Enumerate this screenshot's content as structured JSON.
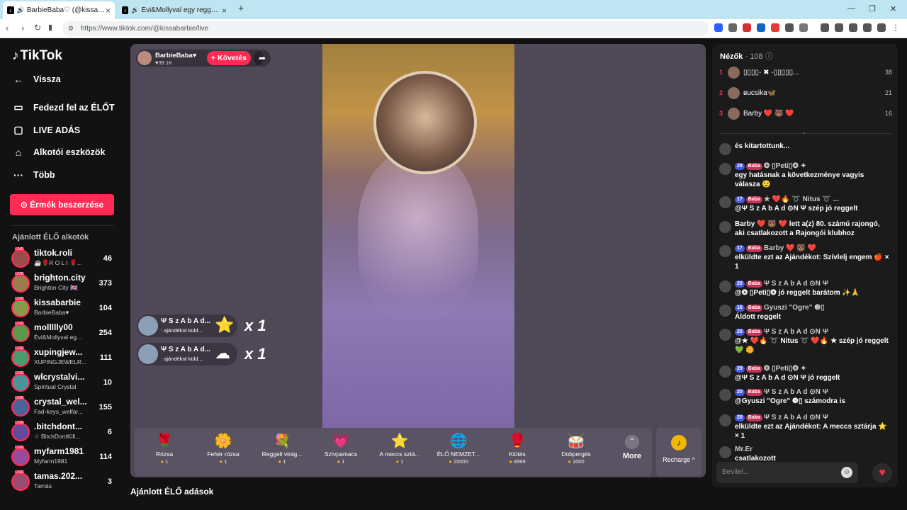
{
  "browser": {
    "tabs": [
      {
        "title": "BarbieBaba♡ (@kissabarbie"
      },
      {
        "title": "Évi&Mollyval egy reggeli 😊😍"
      }
    ],
    "url": "https://www.tiktok.com/@kissabarbie/live"
  },
  "sidebar": {
    "logo": "TikTok",
    "back": "Vissza",
    "nav": [
      "Fedezd fel az ÉLŐT",
      "LIVE ADÁS",
      "Alkotói eszközök",
      "Több"
    ],
    "coins_button": "Érmék beszerzése",
    "section_title": "Ajánlott ÉLŐ alkotók",
    "creators": [
      {
        "name": "tiktok.roli",
        "sub": "☕🌹R O L I 🌹...",
        "count": "46"
      },
      {
        "name": "brighton.city",
        "sub": "Brighton City 🇬🇧",
        "count": "373"
      },
      {
        "name": "kissabarbie",
        "sub": "BarbieBaba♥",
        "count": "104"
      },
      {
        "name": "mollllly00",
        "sub": "Évi&Mollyval eg...",
        "count": "254"
      },
      {
        "name": "xupingjew...",
        "sub": "XUPINGJEWELR...",
        "count": "111"
      },
      {
        "name": "wlcrystalvi...",
        "sub": "Spiritual Crystal",
        "count": "10"
      },
      {
        "name": "crystal_wel...",
        "sub": "Fad-keys_welfar...",
        "count": "155"
      },
      {
        "name": ".bitchdont...",
        "sub": "☆ BitchDontKill...",
        "count": "6"
      },
      {
        "name": "myfarm1981",
        "sub": "Myfarm1981",
        "count": "114"
      },
      {
        "name": "tamas.202...",
        "sub": "Tamás",
        "count": "3"
      }
    ]
  },
  "stream": {
    "host_name": "BarbieBaba♥",
    "host_likes": "♥39.1K",
    "follow": "+ Követés",
    "gift_notes": [
      {
        "user": "Ψ S z A b A d...",
        "text": ": ajándékot küld...",
        "count": "x 1"
      },
      {
        "user": "Ψ S z A b A d...",
        "text": ": ajándékot küld...",
        "count": "x 1"
      }
    ],
    "gifts": [
      {
        "name": "Rózsa",
        "price": "1",
        "icon": "🌹"
      },
      {
        "name": "Fehér rózsa",
        "price": "1",
        "icon": "🌼"
      },
      {
        "name": "Reggeli virág...",
        "price": "1",
        "icon": "💐"
      },
      {
        "name": "Szívpamacs",
        "price": "1",
        "icon": "💗"
      },
      {
        "name": "A meccs sztá...",
        "price": "1",
        "icon": "⭐"
      },
      {
        "name": "ÉLŐ NEMZET...",
        "price": "15000",
        "icon": "🌐"
      },
      {
        "name": "Kiütés",
        "price": "4999",
        "icon": "🥊"
      },
      {
        "name": "Dobpergés",
        "price": "1000",
        "icon": "🥁"
      }
    ],
    "more": "More",
    "recharge": "Recharge ^"
  },
  "below_title": "Ajánlott ÉLŐ adások",
  "chat": {
    "viewers_label": "Nézők",
    "viewers_count": "· 108",
    "top": [
      {
        "rank": "1",
        "name": "▯▯▯▯- ✖ -▯▯▯▯▯...",
        "score": "38"
      },
      {
        "rank": "2",
        "name": "вucsika🦋",
        "score": "21"
      },
      {
        "rank": "3",
        "name": "Barby ❤️ 🐻 ❤️",
        "score": "16"
      }
    ],
    "messages": [
      {
        "badges": [],
        "user": "",
        "text": "és kitartottunk..."
      },
      {
        "badges": [
          "29",
          "Baba"
        ],
        "user": "❂ ▯Peti▯❂ ✦",
        "text": "egy hatásnak a következménye vagyis válasza 😉"
      },
      {
        "badges": [
          "17",
          "Baba"
        ],
        "user": "★ ❤️🔥 ➰ Nitus ➰ ...",
        "text": "@Ψ S z A b A d ⊙N Ψ szép jó reggelt"
      },
      {
        "badges": [],
        "user": "",
        "text": "Barby ❤️ 🐻 ❤️ lett a(z) 80. számú rajongó, aki csatlakozott a Rajongói klubhoz"
      },
      {
        "badges": [
          "17",
          "Baba"
        ],
        "user": "Barby ❤️ 🐻 ❤️",
        "text": "elküldte ezt az Ajándékot: Szívlelj engem 🍎 × 1"
      },
      {
        "badges": [
          "20",
          "Baba"
        ],
        "user": "Ψ S z A b A d ⊙N Ψ",
        "text": "@❂ ▯Peti▯❂ jó reggelt barátom ✨🙏"
      },
      {
        "badges": [
          "16",
          "Baba"
        ],
        "user": "Gyuszi \"Ogre\" ❸▯",
        "text": "Áldott reggelt"
      },
      {
        "badges": [
          "20",
          "Baba"
        ],
        "user": "Ψ S z A b A d ⊙N Ψ",
        "text": "@★ ❤️🔥 ➰ Nitus ➰ ❤️🔥 ★ szép jó reggelt 💚 🌼"
      },
      {
        "badges": [
          "29",
          "Baba"
        ],
        "user": "❂ ▯Peti▯❂ ✦",
        "text": "@Ψ S z A b A d ⊙N Ψ jó reggelt"
      },
      {
        "badges": [
          "20",
          "Baba"
        ],
        "user": "Ψ S z A b A d ⊙N Ψ",
        "text": "@Gyuszi \"Ogre\" ❸▯ számodra is"
      },
      {
        "badges": [
          "20",
          "Baba"
        ],
        "user": "Ψ S z A b A d ⊙N Ψ",
        "text": "elküldte ezt az Ajándékot: A meccs sztárja ⭐ × 1"
      },
      {
        "badges": [],
        "user": "Mr.Er",
        "text": "csatlakozott"
      }
    ],
    "input_placeholder": "Bevitel..."
  },
  "colors": {
    "accent": "#fe2c55",
    "stage": "#4f4857",
    "chat_bg": "#1b1b1b"
  }
}
